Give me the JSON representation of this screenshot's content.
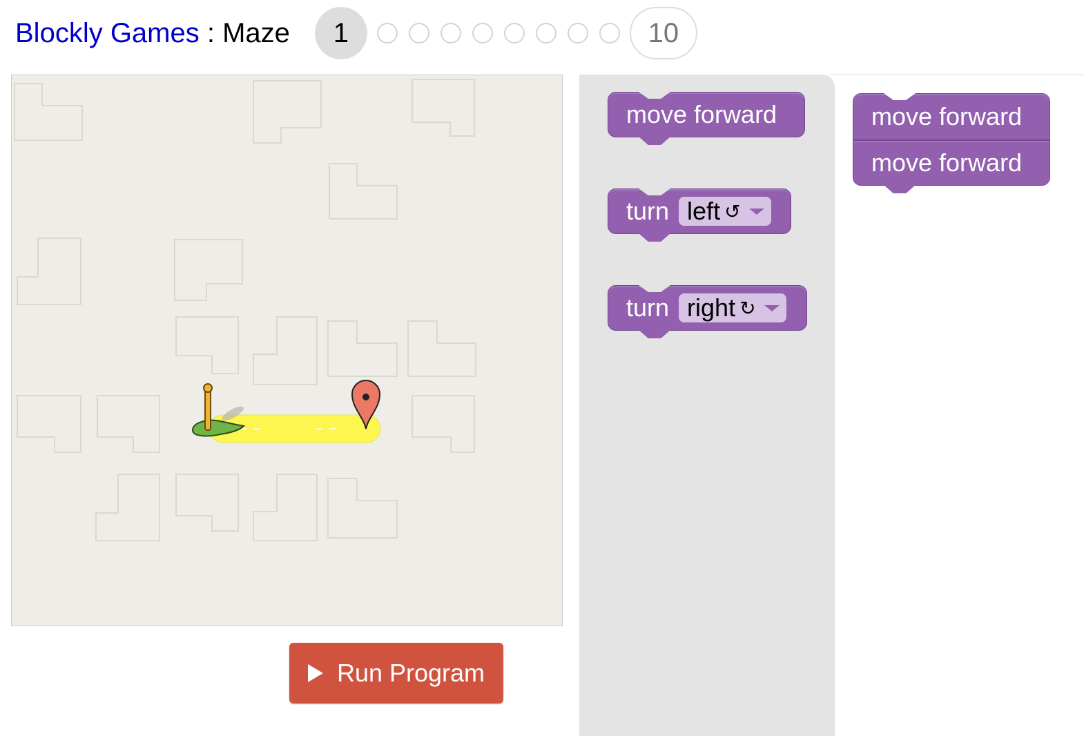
{
  "header": {
    "app_title": "Blockly Games",
    "separator": " : ",
    "game_title": "Maze",
    "current_level": "1",
    "last_level": "10",
    "level_count": 10
  },
  "run_button": {
    "label": "Run Program"
  },
  "toolbox": {
    "blocks": [
      {
        "text": "move forward"
      },
      {
        "text": "turn",
        "dropdown": "left",
        "icon": "↺"
      },
      {
        "text": "turn",
        "dropdown": "right",
        "icon": "↻"
      }
    ]
  },
  "workspace": {
    "blocks": [
      {
        "text": "move forward"
      },
      {
        "text": "move forward"
      }
    ]
  },
  "colors": {
    "block": "#9360b0",
    "run_button": "#d05340",
    "path": "#fcf64f",
    "maze_bg": "#efede7",
    "link": "#0000cc"
  }
}
